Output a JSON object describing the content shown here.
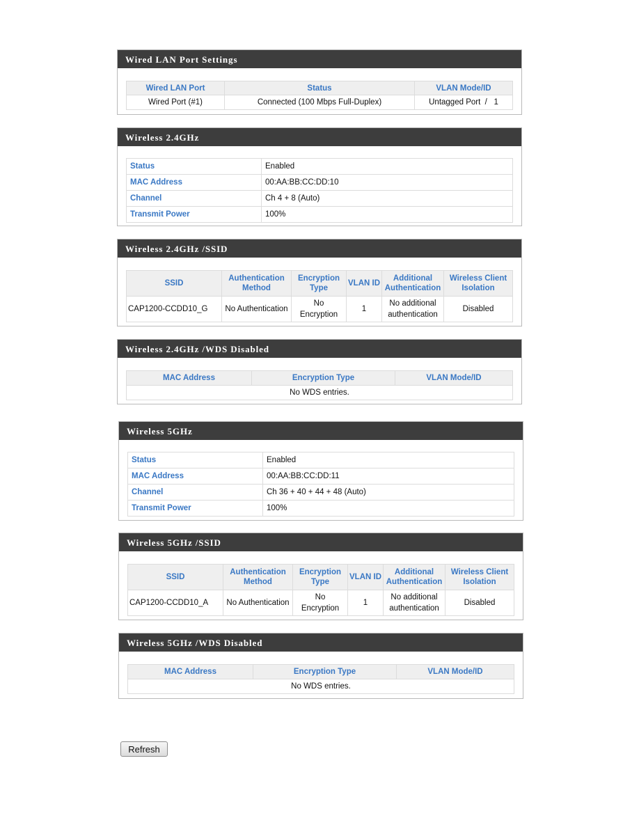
{
  "wired_lan": {
    "title": "Wired LAN Port Settings",
    "columns": [
      "Wired LAN Port",
      "Status",
      "VLAN Mode/ID"
    ],
    "rows": [
      {
        "port": "Wired Port (#1)",
        "status": "Connected (100 Mbps Full-Duplex)",
        "vlan": "Untagged Port  /   1"
      }
    ]
  },
  "wireless_24": {
    "title": "Wireless 2.4GHz",
    "rows": [
      {
        "label": "Status",
        "value": "Enabled"
      },
      {
        "label": "MAC Address",
        "value": "00:AA:BB:CC:DD:10"
      },
      {
        "label": "Channel",
        "value": "Ch 4 + 8 (Auto)"
      },
      {
        "label": "Transmit Power",
        "value": "100%"
      }
    ]
  },
  "wireless_24_ssid": {
    "title": "Wireless 2.4GHz /SSID",
    "columns": [
      "SSID",
      "Authentication Method",
      "Encryption Type",
      "VLAN ID",
      "Additional Authentication",
      "Wireless Client Isolation"
    ],
    "rows": [
      {
        "ssid": "CAP1200-CCDD10_G",
        "auth": "No Authentication",
        "enc": "No Encryption",
        "vlan": "1",
        "additional": "No additional authentication",
        "isolation": "Disabled"
      }
    ]
  },
  "wireless_24_wds": {
    "title": "Wireless 2.4GHz /WDS Disabled",
    "columns": [
      "MAC Address",
      "Encryption Type",
      "VLAN Mode/ID"
    ],
    "empty_message": "No WDS entries."
  },
  "wireless_5": {
    "title": "Wireless 5GHz",
    "rows": [
      {
        "label": "Status",
        "value": "Enabled"
      },
      {
        "label": "MAC Address",
        "value": "00:AA:BB:CC:DD:11"
      },
      {
        "label": "Channel",
        "value": "Ch 36 + 40 + 44 + 48 (Auto)"
      },
      {
        "label": "Transmit Power",
        "value": "100%"
      }
    ]
  },
  "wireless_5_ssid": {
    "title": "Wireless 5GHz /SSID",
    "columns": [
      "SSID",
      "Authentication Method",
      "Encryption Type",
      "VLAN ID",
      "Additional Authentication",
      "Wireless Client Isolation"
    ],
    "rows": [
      {
        "ssid": "CAP1200-CCDD10_A",
        "auth": "No Authentication",
        "enc": "No Encryption",
        "vlan": "1",
        "additional": "No additional authentication",
        "isolation": "Disabled"
      }
    ]
  },
  "wireless_5_wds": {
    "title": "Wireless 5GHz /WDS Disabled",
    "columns": [
      "MAC Address",
      "Encryption Type",
      "VLAN Mode/ID"
    ],
    "empty_message": "No WDS entries."
  },
  "actions": {
    "refresh_label": "Refresh"
  },
  "colors": {
    "panel_header_bg": "#3d3d3d",
    "table_header_text": "#3a78c4",
    "table_header_bg": "#efefef"
  }
}
